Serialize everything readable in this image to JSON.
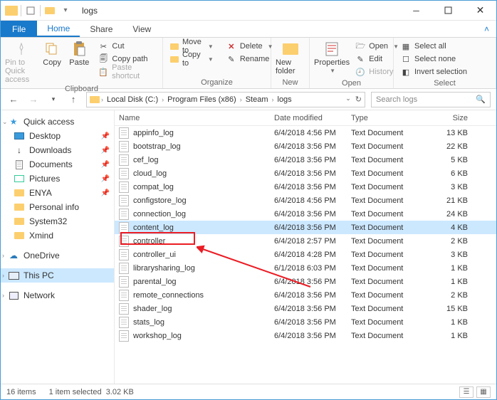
{
  "window": {
    "title": "logs"
  },
  "tabs": {
    "file": "File",
    "home": "Home",
    "share": "Share",
    "view": "View"
  },
  "ribbon": {
    "clipboard": {
      "label": "Clipboard",
      "pin": "Pin to Quick access",
      "copy": "Copy",
      "paste": "Paste",
      "cut": "Cut",
      "copypath": "Copy path",
      "pasteshortcut": "Paste shortcut"
    },
    "organize": {
      "label": "Organize",
      "moveto": "Move to",
      "copyto": "Copy to",
      "delete": "Delete",
      "rename": "Rename"
    },
    "new": {
      "label": "New",
      "newfolder": "New folder"
    },
    "open": {
      "label": "Open",
      "properties": "Properties",
      "open": "Open",
      "edit": "Edit",
      "history": "History"
    },
    "select": {
      "label": "Select",
      "all": "Select all",
      "none": "Select none",
      "invert": "Invert selection"
    }
  },
  "address": {
    "crumbs": [
      "Local Disk (C:)",
      "Program Files (x86)",
      "Steam",
      "logs"
    ]
  },
  "search": {
    "placeholder": "Search logs"
  },
  "sidebar": {
    "quickaccess": "Quick access",
    "items": [
      {
        "label": "Desktop",
        "pinned": true
      },
      {
        "label": "Downloads",
        "pinned": true
      },
      {
        "label": "Documents",
        "pinned": true
      },
      {
        "label": "Pictures",
        "pinned": true
      },
      {
        "label": "ENYA",
        "pinned": true
      },
      {
        "label": "Personal info",
        "pinned": false
      },
      {
        "label": "System32",
        "pinned": false
      },
      {
        "label": "Xmind",
        "pinned": false
      }
    ],
    "onedrive": "OneDrive",
    "thispc": "This PC",
    "network": "Network"
  },
  "columns": {
    "name": "Name",
    "date": "Date modified",
    "type": "Type",
    "size": "Size"
  },
  "files": [
    {
      "name": "appinfo_log",
      "date": "6/4/2018 4:56 PM",
      "type": "Text Document",
      "size": "13 KB"
    },
    {
      "name": "bootstrap_log",
      "date": "6/4/2018 3:56 PM",
      "type": "Text Document",
      "size": "22 KB"
    },
    {
      "name": "cef_log",
      "date": "6/4/2018 3:56 PM",
      "type": "Text Document",
      "size": "5 KB"
    },
    {
      "name": "cloud_log",
      "date": "6/4/2018 3:56 PM",
      "type": "Text Document",
      "size": "6 KB"
    },
    {
      "name": "compat_log",
      "date": "6/4/2018 3:56 PM",
      "type": "Text Document",
      "size": "3 KB"
    },
    {
      "name": "configstore_log",
      "date": "6/4/2018 4:56 PM",
      "type": "Text Document",
      "size": "21 KB"
    },
    {
      "name": "connection_log",
      "date": "6/4/2018 3:56 PM",
      "type": "Text Document",
      "size": "24 KB"
    },
    {
      "name": "content_log",
      "date": "6/4/2018 3:56 PM",
      "type": "Text Document",
      "size": "4 KB",
      "selected": true
    },
    {
      "name": "controller",
      "date": "6/4/2018 2:57 PM",
      "type": "Text Document",
      "size": "2 KB"
    },
    {
      "name": "controller_ui",
      "date": "6/4/2018 4:28 PM",
      "type": "Text Document",
      "size": "3 KB"
    },
    {
      "name": "librarysharing_log",
      "date": "6/1/2018 6:03 PM",
      "type": "Text Document",
      "size": "1 KB"
    },
    {
      "name": "parental_log",
      "date": "6/4/2018 3:56 PM",
      "type": "Text Document",
      "size": "1 KB"
    },
    {
      "name": "remote_connections",
      "date": "6/4/2018 3:56 PM",
      "type": "Text Document",
      "size": "2 KB"
    },
    {
      "name": "shader_log",
      "date": "6/4/2018 3:56 PM",
      "type": "Text Document",
      "size": "15 KB"
    },
    {
      "name": "stats_log",
      "date": "6/4/2018 3:56 PM",
      "type": "Text Document",
      "size": "1 KB"
    },
    {
      "name": "workshop_log",
      "date": "6/4/2018 3:56 PM",
      "type": "Text Document",
      "size": "1 KB"
    }
  ],
  "status": {
    "count": "16 items",
    "selected": "1 item selected",
    "size": "3.02 KB"
  }
}
